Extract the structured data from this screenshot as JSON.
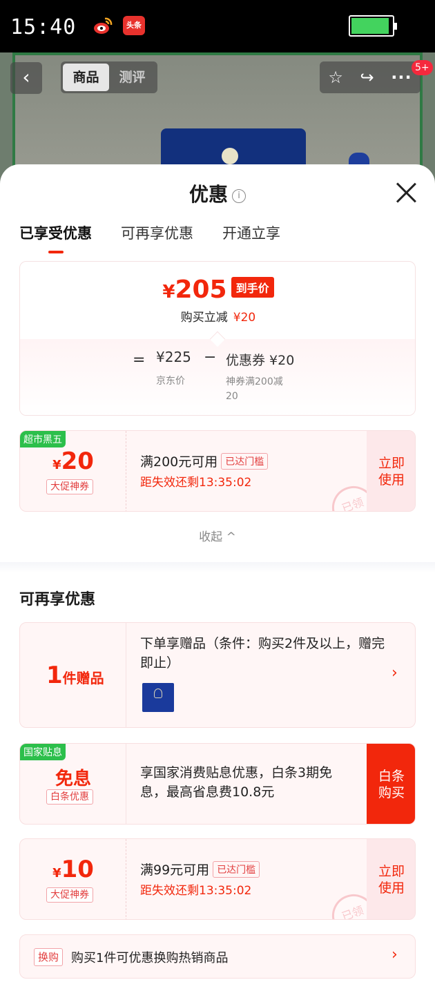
{
  "status_bar": {
    "time": "15:40",
    "app_icons": [
      "weibo-icon",
      "toutiao-icon"
    ],
    "toutiao_label": "头条"
  },
  "product_nav": {
    "back_icon": "chevron-left-icon",
    "tabs": [
      "商品",
      "测评"
    ],
    "active_tab": "商品",
    "actions": [
      "star-icon",
      "share-icon",
      "more-icon"
    ],
    "notification_badge": "5+"
  },
  "sheet": {
    "title": "优惠",
    "info_icon": "i",
    "tabs": [
      "已享受优惠",
      "可再享优惠",
      "开通立享"
    ],
    "active_tab": "已享受优惠"
  },
  "summary": {
    "currency": "¥",
    "final_price": "205",
    "final_tag": "到手价",
    "instant_reduce_label": "购买立减",
    "instant_reduce_value": "¥20",
    "equals": "=",
    "jd_price": "¥225",
    "jd_price_label": "京东价",
    "minus": "−",
    "coupon_line": "优惠券 ¥20",
    "coupon_sub": "神券满200减20"
  },
  "coupon_1": {
    "corner_label": "超市黑五",
    "currency": "¥",
    "amount": "20",
    "type": "大促神券",
    "condition": "满200元可用",
    "status": "已达门槛",
    "expire": "距失效还剩13:35:02",
    "action": "立即\n使用",
    "stamp": "已领"
  },
  "collapse_label": "收起 ^",
  "more_offers": {
    "section_title": "可再享优惠",
    "gift": {
      "amount": "1",
      "unit": "件赠品",
      "description": "下单享赠品（条件：购买2件及以上，赠完即止）"
    },
    "interest": {
      "corner_label": "国家贴息",
      "main": "免息",
      "sub": "白条优惠",
      "description": "享国家消费贴息优惠，白条3期免息，最高省息费10.8元",
      "action": "白条\n购买"
    },
    "coupon_2": {
      "currency": "¥",
      "amount": "10",
      "type": "大促神券",
      "condition": "满99元可用",
      "status": "已达门槛",
      "expire": "距失效还剩13:35:02",
      "action": "立即\n使用",
      "stamp": "已领"
    },
    "swap": {
      "tag": "换购",
      "text": "购买1件可优惠换购热销商品"
    }
  },
  "colors": {
    "accent_red": "#f2270c",
    "green_corner": "#2cbf4b",
    "battery_green": "#43d35e"
  }
}
